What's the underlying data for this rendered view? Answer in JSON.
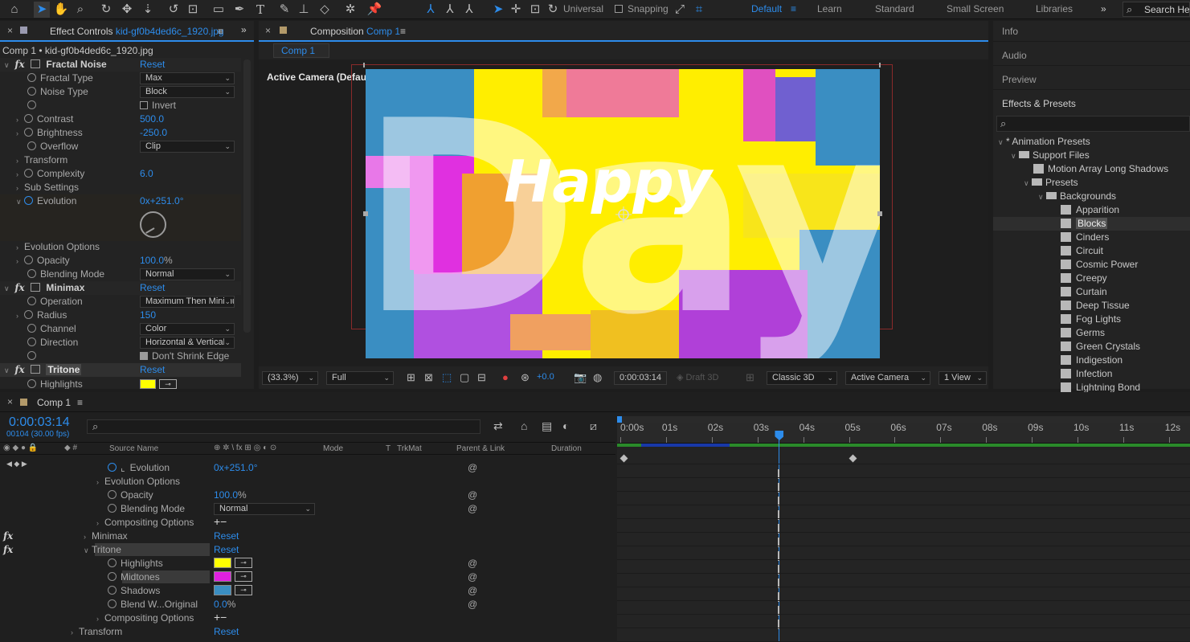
{
  "toolbar": {
    "universal_label": "Universal",
    "snapping_label": "Snapping",
    "workspaces": [
      "Default",
      "Learn",
      "Standard",
      "Small Screen",
      "Libraries"
    ],
    "overflow": "»",
    "search_placeholder": "Search Help"
  },
  "effect_controls": {
    "tab_prefix": "Effect Controls",
    "tab_file": "kid-gf0b4ded6c_1920.jpg",
    "breadcrumb": "Comp 1 • kid-gf0b4ded6c_1920.jpg",
    "fractal": {
      "name": "Fractal Noise",
      "reset": "Reset",
      "fractal_type_label": "Fractal Type",
      "fractal_type_value": "Max",
      "noise_type_label": "Noise Type",
      "noise_type_value": "Block",
      "invert_label": "Invert",
      "contrast_label": "Contrast",
      "contrast_value": "500.0",
      "brightness_label": "Brightness",
      "brightness_value": "-250.0",
      "overflow_label": "Overflow",
      "overflow_value": "Clip",
      "transform_label": "Transform",
      "complexity_label": "Complexity",
      "complexity_value": "6.0",
      "sub_settings_label": "Sub Settings",
      "evolution_label": "Evolution",
      "evolution_value": "0x+251.0°",
      "evolution_options_label": "Evolution Options",
      "opacity_label": "Opacity",
      "opacity_value": "100.0",
      "opacity_unit": "%",
      "blending_label": "Blending Mode",
      "blending_value": "Normal"
    },
    "minimax": {
      "name": "Minimax",
      "reset": "Reset",
      "operation_label": "Operation",
      "operation_value": "Maximum Then Minimum",
      "radius_label": "Radius",
      "radius_value": "150",
      "channel_label": "Channel",
      "channel_value": "Color",
      "direction_label": "Direction",
      "direction_value": "Horizontal & Vertical",
      "dont_shrink_label": "Don't Shrink Edge"
    },
    "tritone": {
      "name": "Tritone",
      "reset": "Reset",
      "highlights_label": "Highlights"
    }
  },
  "composition": {
    "tab_prefix": "Composition",
    "tab_name": "Comp 1",
    "sub_tab": "Comp 1",
    "camera_label": "Active Camera (Default)",
    "happy_text": "Happy",
    "day_text": "Day",
    "zoom": "(33.3%)",
    "resolution": "Full",
    "exposure": "+0.0",
    "timecode": "0:00:03:14",
    "draft3d": "Draft 3D",
    "renderer": "Classic 3D",
    "camera_dd": "Active Camera",
    "view_dd": "1 View"
  },
  "right_panel": {
    "sections": [
      "Info",
      "Audio",
      "Preview",
      "Effects & Presets"
    ],
    "tree_root": "* Animation Presets",
    "support_files": "Support Files",
    "motion_array": "Motion Array Long Shadows",
    "presets": "Presets",
    "backgrounds": "Backgrounds",
    "items": [
      "Apparition",
      "Blocks",
      "Cinders",
      "Circuit",
      "Cosmic Power",
      "Creepy",
      "Curtain",
      "Deep Tissue",
      "Fog Lights",
      "Germs",
      "Green Crystals",
      "Indigestion",
      "Infection",
      "Lightning Bond"
    ],
    "selected": "Blocks"
  },
  "timeline": {
    "tab": "Comp 1",
    "timecode": "0:00:03:14",
    "frame_info": "00104 (30.00 fps)",
    "col_source": "Source Name",
    "col_mode": "Mode",
    "col_t": "T",
    "col_trkmat": "TrkMat",
    "col_parent": "Parent & Link",
    "col_duration": "Duration",
    "ruler": [
      "0:00s",
      "01s",
      "02s",
      "03s",
      "04s",
      "05s",
      "06s",
      "07s",
      "08s",
      "09s",
      "10s",
      "11s",
      "12s"
    ],
    "playhead_seconds": 3.47,
    "rows": {
      "evolution_label": "Evolution",
      "evolution_value": "0x+251.0°",
      "evolution_options": "Evolution Options",
      "opacity_label": "Opacity",
      "opacity_value": "100.0",
      "opacity_unit": "%",
      "blending_label": "Blending Mode",
      "blending_value": "Normal",
      "compositing1": "Compositing Options",
      "minimax": "Minimax",
      "minimax_reset": "Reset",
      "tritone": "Tritone",
      "tritone_reset": "Reset",
      "highlights": "Highlights",
      "midtones": "Midtones",
      "shadows": "Shadows",
      "blend": "Blend W...Original",
      "blend_value": "0.0",
      "blend_unit": "%",
      "compositing2": "Compositing Options",
      "transform": "Transform",
      "transform_reset": "Reset",
      "plus_minus": "+−"
    },
    "keyframe_seconds": [
      0,
      5
    ]
  },
  "colors": {
    "accent": "#2d8ceb",
    "highlights": "#ffff00",
    "midtones": "#e020e0",
    "shadows": "#3a8ec2"
  }
}
